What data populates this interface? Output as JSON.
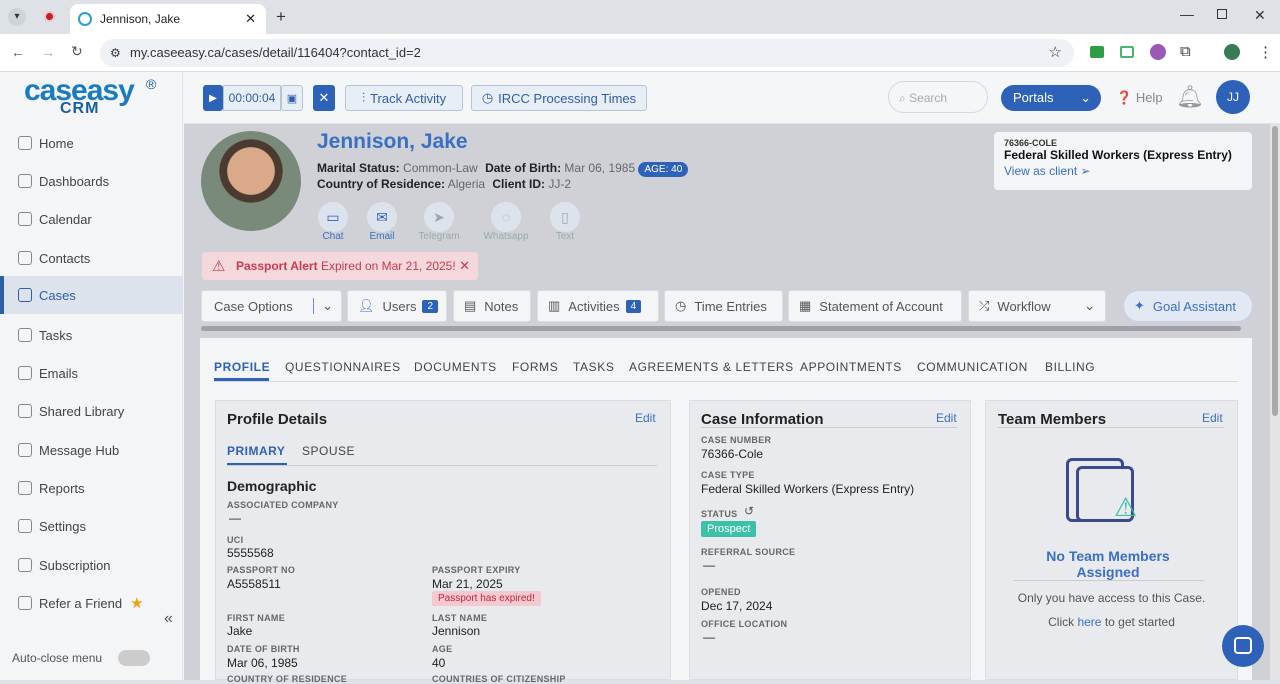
{
  "browser": {
    "tab_title": "Jennison, Jake",
    "url": "my.caseeasy.ca/cases/detail/116404?contact_id=2"
  },
  "logo": {
    "text_a": "caseasy",
    "text_b": "CRM",
    "reg": "®"
  },
  "sidebar": {
    "items": [
      {
        "label": "Home"
      },
      {
        "label": "Dashboards"
      },
      {
        "label": "Calendar"
      },
      {
        "label": "Contacts"
      },
      {
        "label": "Cases"
      },
      {
        "label": "Tasks"
      },
      {
        "label": "Emails"
      },
      {
        "label": "Shared Library"
      },
      {
        "label": "Message Hub"
      },
      {
        "label": "Reports"
      },
      {
        "label": "Settings"
      },
      {
        "label": "Subscription"
      },
      {
        "label": "Refer a Friend"
      }
    ],
    "auto_close": "Auto-close menu"
  },
  "topbar": {
    "timer": "00:00:04",
    "track_activity": "Track Activity",
    "ircc": "IRCC Processing Times",
    "search_placeholder": "Search",
    "portals": "Portals",
    "help": "Help",
    "avatar": "JJ"
  },
  "client": {
    "name": "Jennison, Jake",
    "marital_label": "Marital Status:",
    "marital_value": "Common-Law",
    "dob_label": "Date of Birth:",
    "dob_value": "Mar 06, 1985",
    "age_badge": "AGE: 40",
    "country_label": "Country of Residence:",
    "country_value": "Algeria",
    "client_id_label": "Client ID:",
    "client_id_value": "JJ-2"
  },
  "contact_methods": [
    {
      "label": "Chat"
    },
    {
      "label": "Email"
    },
    {
      "label": "Telegram"
    },
    {
      "label": "Whatsapp"
    },
    {
      "label": "Text"
    }
  ],
  "case_ref": {
    "code": "76366-COLE",
    "type": "Federal Skilled Workers (Express Entry)",
    "link": "View as client"
  },
  "alert": {
    "title": "Passport Alert",
    "text": "Expired on Mar 21, 2025!"
  },
  "actions": {
    "case_options": "Case Options",
    "users": "Users",
    "users_count": "2",
    "notes": "Notes",
    "activities": "Activities",
    "activities_count": "4",
    "time_entries": "Time Entries",
    "statement": "Statement of Account",
    "workflow": "Workflow",
    "goal": "Goal Assistant"
  },
  "content_tabs": [
    "PROFILE",
    "QUESTIONNAIRES",
    "DOCUMENTS",
    "FORMS",
    "TASKS",
    "AGREEMENTS & LETTERS",
    "APPOINTMENTS",
    "COMMUNICATION",
    "BILLING"
  ],
  "profile": {
    "title": "Profile Details",
    "edit": "Edit",
    "tab_primary": "PRIMARY",
    "tab_spouse": "SPOUSE",
    "section": "Demographic",
    "assoc_company_label": "ASSOCIATED COMPANY",
    "assoc_company_value": "—",
    "uci_label": "UCI",
    "uci_value": "5555568",
    "passport_no_label": "PASSPORT NO",
    "passport_no_value": "A5558511",
    "passport_expiry_label": "PASSPORT EXPIRY",
    "passport_expiry_value": "Mar 21, 2025",
    "passport_expired": "Passport has expired!",
    "first_name_label": "FIRST NAME",
    "first_name_value": "Jake",
    "last_name_label": "LAST NAME",
    "last_name_value": "Jennison",
    "dob_label": "DATE OF BIRTH",
    "dob_value": "Mar 06, 1985",
    "age_label": "AGE",
    "age_value": "40",
    "country_res_label": "COUNTRY OF RESIDENCE",
    "countries_cit_label": "COUNTRIES OF CITIZENSHIP"
  },
  "case_info": {
    "title": "Case Information",
    "edit": "Edit",
    "case_number_label": "CASE NUMBER",
    "case_number_value": "76366-Cole",
    "case_type_label": "CASE TYPE",
    "case_type_value": "Federal Skilled Workers (Express Entry)",
    "status_label": "STATUS",
    "status_value": "Prospect",
    "referral_label": "REFERRAL SOURCE",
    "referral_value": "—",
    "opened_label": "OPENED",
    "opened_value": "Dec 17, 2024",
    "office_label": "OFFICE LOCATION",
    "office_value": "—"
  },
  "team": {
    "title": "Team Members",
    "edit": "Edit",
    "empty_title": "No Team Members Assigned",
    "empty_text": "Only you have access to this Case.",
    "click": "Click",
    "here": "here",
    "get_started": "to get started"
  }
}
